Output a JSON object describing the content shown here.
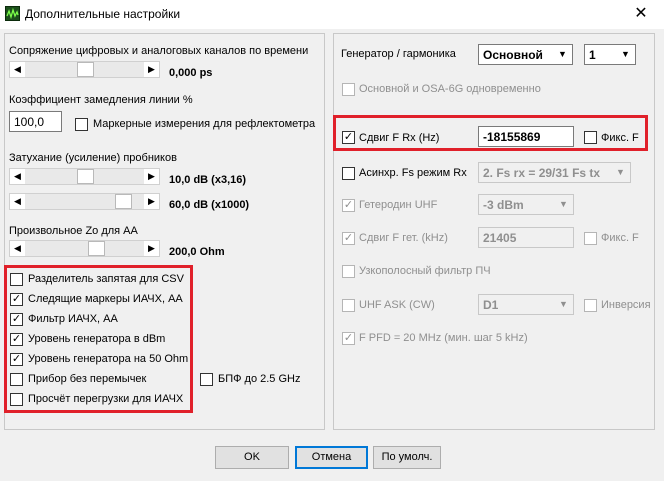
{
  "window": {
    "title": "Дополнительные настройки",
    "close_glyph": "✕"
  },
  "left": {
    "sync_label": "Сопряжение цифровых и аналоговых каналов по времени",
    "sync_value": "0,000 ps",
    "slow_label": "Коэффициент замедления линии %",
    "slow_value": "100,0",
    "marker_refl_label": "Маркерные измерения для рефлектометра",
    "atten_label": "Затухание (усиление) пробников",
    "atten1_value": "10,0 dB (x3,16)",
    "atten2_value": "60,0 dB (x1000)",
    "zo_label": "Произвольное Zo для АА",
    "zo_value": "200,0 Ohm",
    "checkboxes": [
      {
        "label": "Разделитель запятая для CSV",
        "checked": false
      },
      {
        "label": "Следящие маркеры ИАЧХ, АА",
        "checked": true
      },
      {
        "label": "Фильтр ИАЧХ, АА",
        "checked": true
      },
      {
        "label": "Уровень генератора в dBm",
        "checked": true
      },
      {
        "label": "Уровень генератора на 50 Ohm",
        "checked": true
      },
      {
        "label": "Прибор без перемычек",
        "checked": false
      },
      {
        "label": "Просчёт перегрузки для ИАЧХ",
        "checked": false
      }
    ],
    "bpf_label": "БПФ до 2.5 GHz"
  },
  "right": {
    "gen_label": "Генератор / гармоника",
    "gen_value": "Основной",
    "harm_value": "1",
    "osa_label": "Основной и OSA-6G одновременно",
    "shift_rx_label": "Сдвиг F Rx (Hz)",
    "shift_rx_value": "-18155869",
    "fix_f_label": "Фикс. F",
    "async_label": "Асинхр. Fs режим Rx",
    "async_value": "2. Fs rx = 29/31 Fs tx",
    "het_label": "Гетеродин UHF",
    "het_value": "-3 dBm",
    "shift_gen_label": "Сдвиг F гет. (kHz)",
    "shift_gen_value": "21405",
    "fix_f2_label": "Фикс. F",
    "narrow_label": "Узкополосный фильтр ПЧ",
    "uhf_ask_label": "UHF ASK (CW)",
    "uhf_ask_value": "D1",
    "inversion_label": "Инверсия",
    "pfd_label": "F PFD = 20 MHz (мин. шаг 5 kHz)",
    "check_glyph": "✓"
  },
  "buttons": {
    "ok": "OK",
    "cancel": "Отмена",
    "defaults": "По умолч."
  },
  "colors": {
    "highlight": "#e0202a",
    "focus": "#0078d7"
  }
}
